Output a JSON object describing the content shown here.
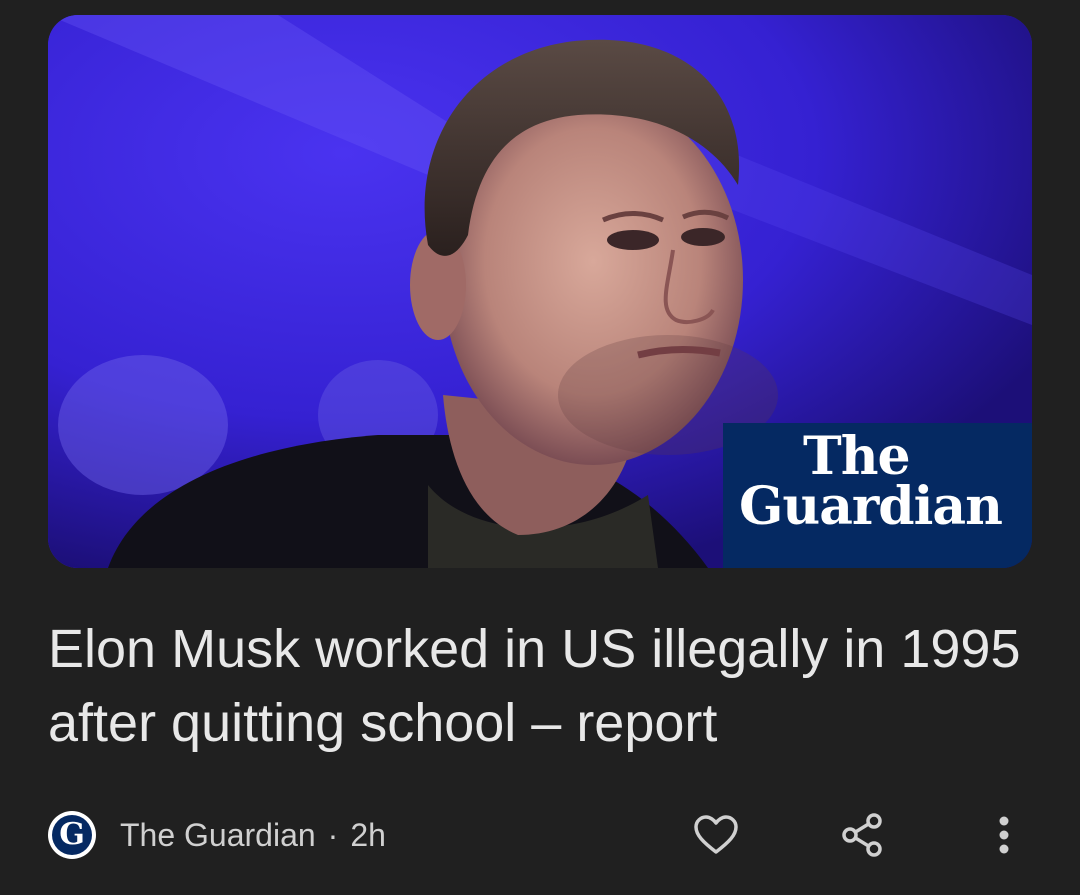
{
  "article": {
    "image_alt": "Elon Musk",
    "logo_text_line1": "The",
    "logo_text_line2": "Guardian",
    "headline": "Elon Musk worked in US illegally in 1995 after quitting school – report",
    "source_name": "The Guardian",
    "source_icon_letter": "G",
    "separator": "·",
    "time": "2h"
  },
  "actions": [
    {
      "icon": "heart-icon"
    },
    {
      "icon": "share-icon"
    },
    {
      "icon": "more-vert-icon"
    }
  ],
  "colors": {
    "background": "#202020",
    "guardian_blue": "#052962",
    "headline": "#e8e8e8",
    "meta": "#d0d0d0"
  }
}
